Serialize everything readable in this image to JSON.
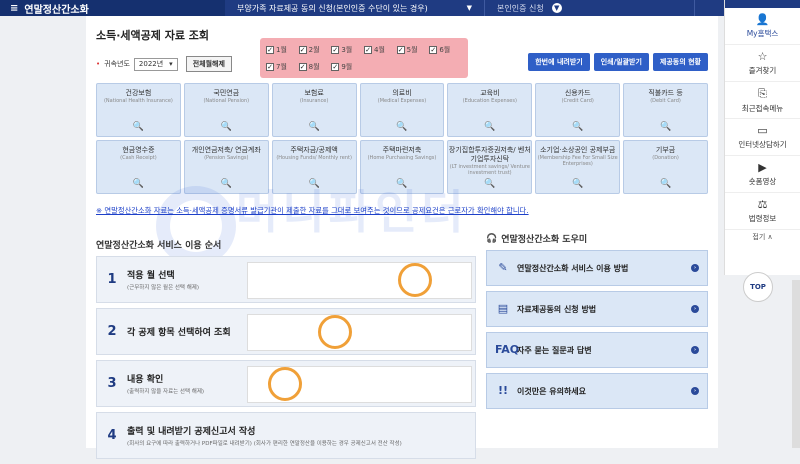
{
  "topbar": {
    "menu": "연말정산간소화",
    "crumb1": "부양가족 자료제공 동의 신청(본인인증 수단이 있는 경우)",
    "crumb2": "본인인증 신청"
  },
  "page": {
    "title": "소득·세액공제 자료 조회"
  },
  "controls": {
    "year_label": "귀속년도",
    "year_value": "2022년",
    "select_all": "전체월해제"
  },
  "months": [
    "1월",
    "2월",
    "3월",
    "4월",
    "5월",
    "6월",
    "7월",
    "8월",
    "9월"
  ],
  "actions": [
    "한번에 내려받기",
    "인쇄/일괄받기",
    "제공동의 현황"
  ],
  "categories": [
    {
      "title": "건강보험",
      "en": "(National Health Insurance)"
    },
    {
      "title": "국민연금",
      "en": "(National Pension)"
    },
    {
      "title": "보험료",
      "en": "(Insurance)"
    },
    {
      "title": "의료비",
      "en": "(Medical Expenses)"
    },
    {
      "title": "교육비",
      "en": "(Education Expenses)"
    },
    {
      "title": "신용카드",
      "en": "(Credit Card)"
    },
    {
      "title": "직불카드 등",
      "en": "(Debit Card)"
    },
    {
      "title": "현금영수증",
      "en": "(Cash Receipt)"
    },
    {
      "title": "개인연금저축/ 연금계좌",
      "en": "(Pension Savings)"
    },
    {
      "title": "주택자금/공제액",
      "en": "(Housing Funds/ Monthly rent)"
    },
    {
      "title": "주택마련저축",
      "en": "(Home Purchasing Savings)"
    },
    {
      "title": "장기집합투자증권저축/ 벤처기업투자신탁",
      "en": "(LT investment savings/ Venture investment trust)"
    },
    {
      "title": "소기업·소상공인 공제부금",
      "en": "(Membership Fee For Small Size Enterprises)"
    },
    {
      "title": "기부금",
      "en": "(Donation)"
    }
  ],
  "notice": "※ 연말정산간소화 자료는 소득·세액공제 증명서류 발급기관이 제출한 자료를 그대로 보여주는 것이므로 공제요건은 근로자가 확인해야 합니다.",
  "watermark": "머니파인더",
  "guide": {
    "title": "연말정산간소화 서비스 이용 순서",
    "steps": [
      {
        "num": "1",
        "title": "적용 월 선택",
        "sub": "(근무하지 않은 월은 선택 해제)"
      },
      {
        "num": "2",
        "title": "각 공제 항목 선택하여 조회",
        "sub": ""
      },
      {
        "num": "3",
        "title": "내용 확인",
        "sub": "(출력하지 않을 자료는 선택 해제)"
      },
      {
        "num": "4",
        "title": "출력 및 내려받기 공제신고서 작성",
        "sub": "(회사의 요구에 따라 출력하거나 PDF파일로 내려받기) (회사가 편리한 연말정산을 이용하는 경우 공제신고서 전산 작성)"
      }
    ]
  },
  "helper": {
    "title": "연말정산간소화 도우미",
    "items": [
      "연말정산간소화 서비스 이용 방법",
      "자료제공동의 신청 방법",
      "자주 묻는 질문과 답변",
      "이것만은 유의하세요"
    ]
  },
  "side": {
    "items": [
      "My홈택스",
      "즐겨찾기",
      "최근접속메뉴",
      "인터넷상담하기",
      "숏폼영상",
      "법령정보"
    ],
    "fold": "접기",
    "top": "TOP"
  }
}
